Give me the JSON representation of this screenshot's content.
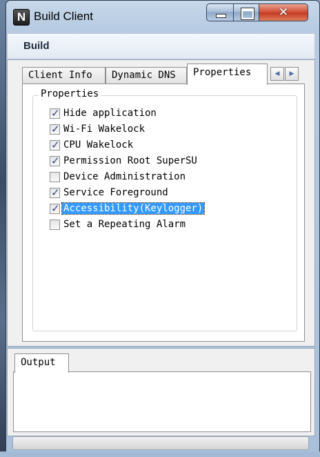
{
  "window": {
    "title": "Build Client",
    "app_icon_letter": "N",
    "controls": {
      "minimize": "minimize",
      "maximize": "maximize",
      "close": "✕"
    }
  },
  "menu": {
    "build": "Build"
  },
  "tabs": [
    {
      "label": "Client Info",
      "active": false
    },
    {
      "label": "Dynamic DNS",
      "active": false
    },
    {
      "label": "Properties",
      "active": true
    }
  ],
  "tab_scroll": {
    "left": "◀",
    "right": "▶"
  },
  "properties_group": {
    "title": "Properties",
    "options": [
      {
        "label": "Hide application",
        "checked": true
      },
      {
        "label": "Wi-Fi Wakelock",
        "checked": true
      },
      {
        "label": "CPU Wakelock",
        "checked": true
      },
      {
        "label": "Permission Root SuperSU",
        "checked": true
      },
      {
        "label": "Device Administration",
        "checked": false
      },
      {
        "label": "Service Foreground",
        "checked": true
      },
      {
        "label": "Accessibility(Keylogger)",
        "checked": true,
        "selected": true
      },
      {
        "label": "Set a Repeating Alarm",
        "checked": false
      }
    ]
  },
  "output": {
    "tab_label": "Output",
    "content": ""
  },
  "colors": {
    "selection": "#3399ff",
    "close_button": "#c33d22",
    "check": "#2c4a86"
  }
}
